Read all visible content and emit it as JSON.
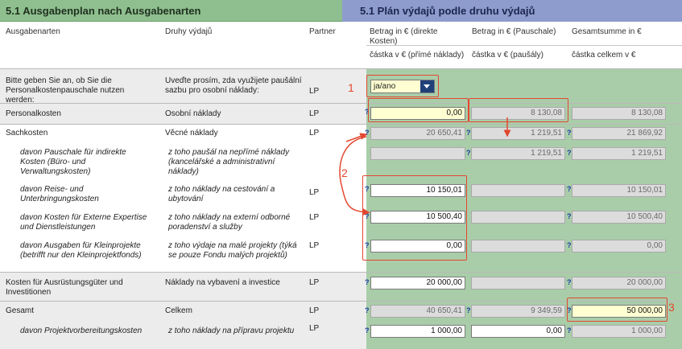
{
  "header": {
    "left_title": "5.1 Ausgabenplan nach Ausgabenarten",
    "right_title": "5.1 Plán výdajů podle druhu výdajů"
  },
  "columns": {
    "ausgabenarten": "Ausgabenarten",
    "druhy": "Druhy výdajů",
    "partner": "Partner",
    "betrag_direkt": "Betrag in € (direkte Kosten)",
    "betrag_direkt_cz": "částka v € (přímé náklady)",
    "betrag_pauschal": "Betrag in € (Pauschale)",
    "betrag_pauschal_cz": "částka v € (paušály)",
    "gesamt": "Gesamtsumme in €",
    "gesamt_cz": "částka celkem v €"
  },
  "rows": [
    {
      "de": "Bitte geben Sie an, ob Sie die Personalkostenpauschale nutzen werden:",
      "cz": "Uveďte prosím, zda využijete paušální sazbu pro osobní náklady:",
      "partner": "LP",
      "select_value": "ja/ano"
    },
    {
      "de": "Personalkosten",
      "cz": "Osobní náklady",
      "partner": "LP",
      "direkt": "0,00",
      "pauschal": "8 130,08",
      "gesamt": "8 130,08"
    },
    {
      "de": "Sachkosten",
      "cz": "Věcné náklady",
      "partner": "LP",
      "direkt": "20 650,41",
      "pauschal": "1 219,51",
      "gesamt": "21 869,92"
    },
    {
      "de": "davon Pauschale für indirekte Kosten (Büro- und Verwaltungskosten)",
      "cz": "z toho paušál na nepřímé náklady (kancelářské a administrativní náklady)",
      "partner": "",
      "direkt": "",
      "pauschal": "1 219,51",
      "gesamt": "1 219,51"
    },
    {
      "de": "davon Reise- und Unterbringungskosten",
      "cz": "z toho náklady na cestování a ubytování",
      "partner": "LP",
      "direkt": "10 150,01",
      "pauschal": "",
      "gesamt": "10 150,01"
    },
    {
      "de": "davon Kosten für Externe Expertise und Dienstleistungen",
      "cz": "z toho náklady na externí odborné poradenství a služby",
      "partner": "LP",
      "direkt": "10 500,40",
      "pauschal": "",
      "gesamt": "10 500,40"
    },
    {
      "de": "davon Ausgaben für Kleinprojekte (betrifft nur den Kleinprojektfonds)",
      "cz": "z toho výdaje na malé projekty (týká se pouze Fondu malých projektů)",
      "partner": "LP",
      "direkt": "0,00",
      "pauschal": "",
      "gesamt": "0,00"
    },
    {
      "de": "Kosten für Ausrüstungsgüter und Investitionen",
      "cz": "Náklady na vybavení a investice",
      "partner": "LP",
      "direkt": "20 000,00",
      "pauschal": "",
      "gesamt": "20 000,00"
    },
    {
      "de": "Gesamt",
      "cz": "Celkem",
      "partner": "LP",
      "direkt": "40 650,41",
      "pauschal": "9 349,59",
      "gesamt": "50 000,00"
    },
    {
      "de": "davon Projektvorbereitungskosten",
      "cz": "z toho náklady na přípravu projektu",
      "partner": "LP",
      "direkt": "1 000,00",
      "pauschal": "0,00",
      "gesamt": "1 000,00"
    }
  ],
  "help_mark": "?",
  "annotations": [
    "1",
    "2",
    "3"
  ],
  "colors": {
    "header_green": "#8fbf8f",
    "header_blue": "#8d9ccc",
    "panel_green": "#a9cda9",
    "annotation_red": "#e2472f",
    "input_yellow": "#ffffd2",
    "dropdown_blue": "#20407a"
  }
}
